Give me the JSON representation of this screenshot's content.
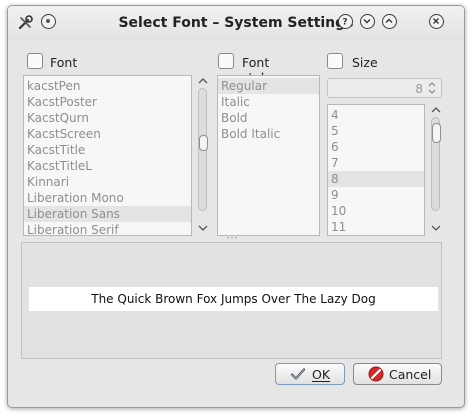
{
  "window": {
    "title": "Select Font – System Settings",
    "buttons": [
      {
        "name": "help-button",
        "icon": "question-icon"
      },
      {
        "name": "minimize-button",
        "icon": "chevron-down-icon"
      },
      {
        "name": "maximize-button",
        "icon": "chevron-up-icon"
      },
      {
        "name": "close-button",
        "icon": "close-icon"
      }
    ]
  },
  "font_column": {
    "label": "Font",
    "fonts": [
      {
        "label": "kacstPen",
        "selected": false
      },
      {
        "label": "KacstPoster",
        "selected": false
      },
      {
        "label": "KacstQurn",
        "selected": false
      },
      {
        "label": "KacstScreen",
        "selected": false
      },
      {
        "label": "KacstTitle",
        "selected": false
      },
      {
        "label": "KacstTitleL",
        "selected": false
      },
      {
        "label": "Kinnari",
        "selected": false
      },
      {
        "label": "Liberation Mono",
        "selected": false
      },
      {
        "label": "Liberation Sans",
        "selected": true
      },
      {
        "label": "Liberation Serif",
        "selected": false
      }
    ]
  },
  "style_column": {
    "label": "Font style",
    "styles": [
      {
        "label": "Regular",
        "selected": true
      },
      {
        "label": "Italic",
        "selected": false
      },
      {
        "label": "Bold",
        "selected": false
      },
      {
        "label": "Bold Italic",
        "selected": false
      }
    ]
  },
  "size_column": {
    "label": "Size",
    "spin_value": "8",
    "sizes": [
      {
        "label": "4",
        "selected": false
      },
      {
        "label": "5",
        "selected": false
      },
      {
        "label": "6",
        "selected": false
      },
      {
        "label": "7",
        "selected": false
      },
      {
        "label": "8",
        "selected": true
      },
      {
        "label": "9",
        "selected": false
      },
      {
        "label": "10",
        "selected": false
      },
      {
        "label": "11",
        "selected": false
      }
    ]
  },
  "preview": {
    "text": "The Quick Brown Fox Jumps Over The Lazy Dog"
  },
  "buttons": {
    "ok_label": "OK",
    "cancel_label": "Cancel"
  },
  "colors": {
    "ok_border": "#7d9ac0",
    "cancel_icon": "#d42a2a"
  }
}
